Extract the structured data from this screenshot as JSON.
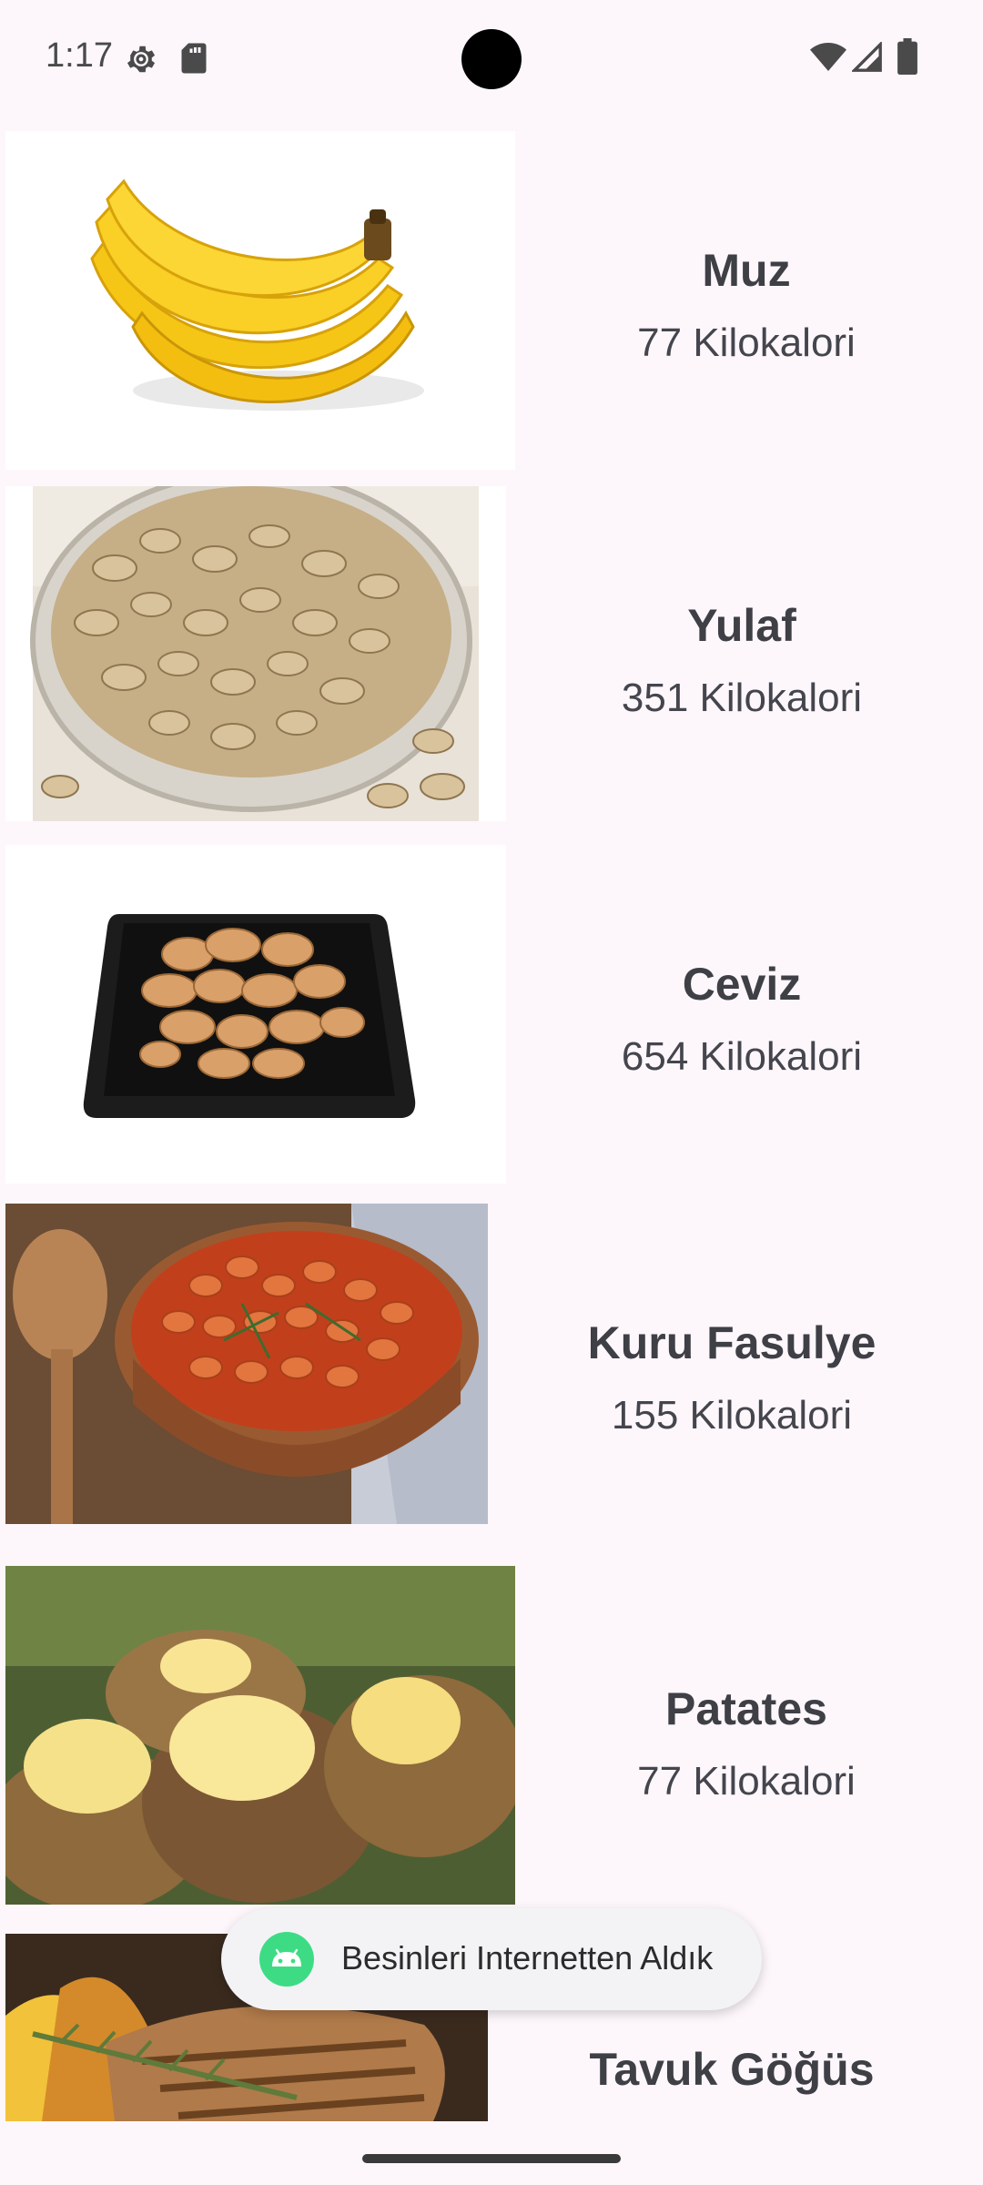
{
  "status_bar": {
    "time": "1:17",
    "icons": [
      "gear-icon",
      "sd-card-icon",
      "wifi-icon",
      "cell-signal-icon",
      "battery-icon"
    ]
  },
  "foods": [
    {
      "name": "Muz",
      "calories": "77 Kilokalori",
      "image": "banana-image"
    },
    {
      "name": "Yulaf",
      "calories": "351 Kilokalori",
      "image": "oats-image"
    },
    {
      "name": "Ceviz",
      "calories": "654 Kilokalori",
      "image": "walnut-image"
    },
    {
      "name": "Kuru Fasulye",
      "calories": "155 Kilokalori",
      "image": "baked-beans-image"
    },
    {
      "name": "Patates",
      "calories": "77 Kilokalori",
      "image": "baked-potato-image"
    },
    {
      "name": "Tavuk Göğüs",
      "calories": "",
      "image": "chicken-breast-image"
    }
  ],
  "toast": {
    "message": "Besinleri Internetten Aldık",
    "icon": "android-icon"
  },
  "colors": {
    "background": "#FDF7FC",
    "text": "#3f3f46",
    "toast_bg": "#F3F3F6",
    "android_green": "#3DDC84"
  }
}
